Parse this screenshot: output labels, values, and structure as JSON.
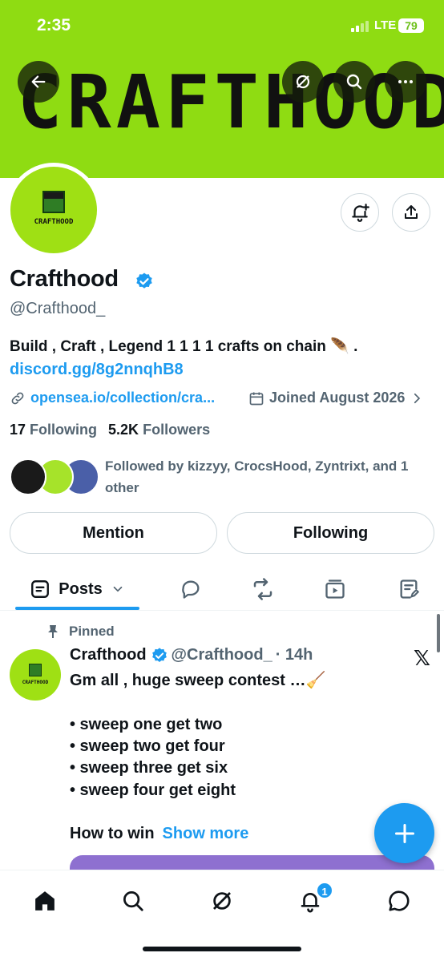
{
  "status_bar": {
    "time": "2:35",
    "network": "LTE",
    "battery": "79"
  },
  "banner": {
    "text": "CRAFTHOOD",
    "color": "#8fdc12"
  },
  "header_buttons": {
    "back_icon": "arrow-left-icon",
    "grok_icon": "grok-icon",
    "search_icon": "search-icon",
    "more_icon": "more-icon"
  },
  "profile": {
    "avatar_text": "CRAFTHOOD",
    "display_name": "Crafthood",
    "handle": "@Crafthood_",
    "bio": "Build , Craft , Legend 1 1 1 1 crafts on chain 🪶 .",
    "bio_link": "discord.gg/8g2nnqhB8",
    "website": "opensea.io/collection/cra...",
    "joined": "Joined August 2026",
    "following_count": "17",
    "following_label": "Following",
    "followers_count": "5.2K",
    "followers_label": "Followers",
    "followed_by": "Followed by kizzyy, CrocsHood, Zyntrixt, and 1 other"
  },
  "actions": {
    "mention": "Mention",
    "following": "Following"
  },
  "tabs": {
    "posts": "Posts"
  },
  "pinned_post": {
    "pinned_label": "Pinned",
    "author": "Crafthood",
    "handle": "@Crafthood_",
    "time": "· 14h",
    "line1": "Gm all , huge sweep contest …🧹",
    "bullets": [
      "• sweep one get two",
      "• sweep two get four",
      "• sweep three get six",
      "• sweep four get eight"
    ],
    "how_to_win": "How to win",
    "show_more": "Show more"
  },
  "nav": {
    "notifications_badge": "1"
  },
  "colors": {
    "accent": "#1d9bf0",
    "text": "#0f1419",
    "muted": "#536471"
  }
}
